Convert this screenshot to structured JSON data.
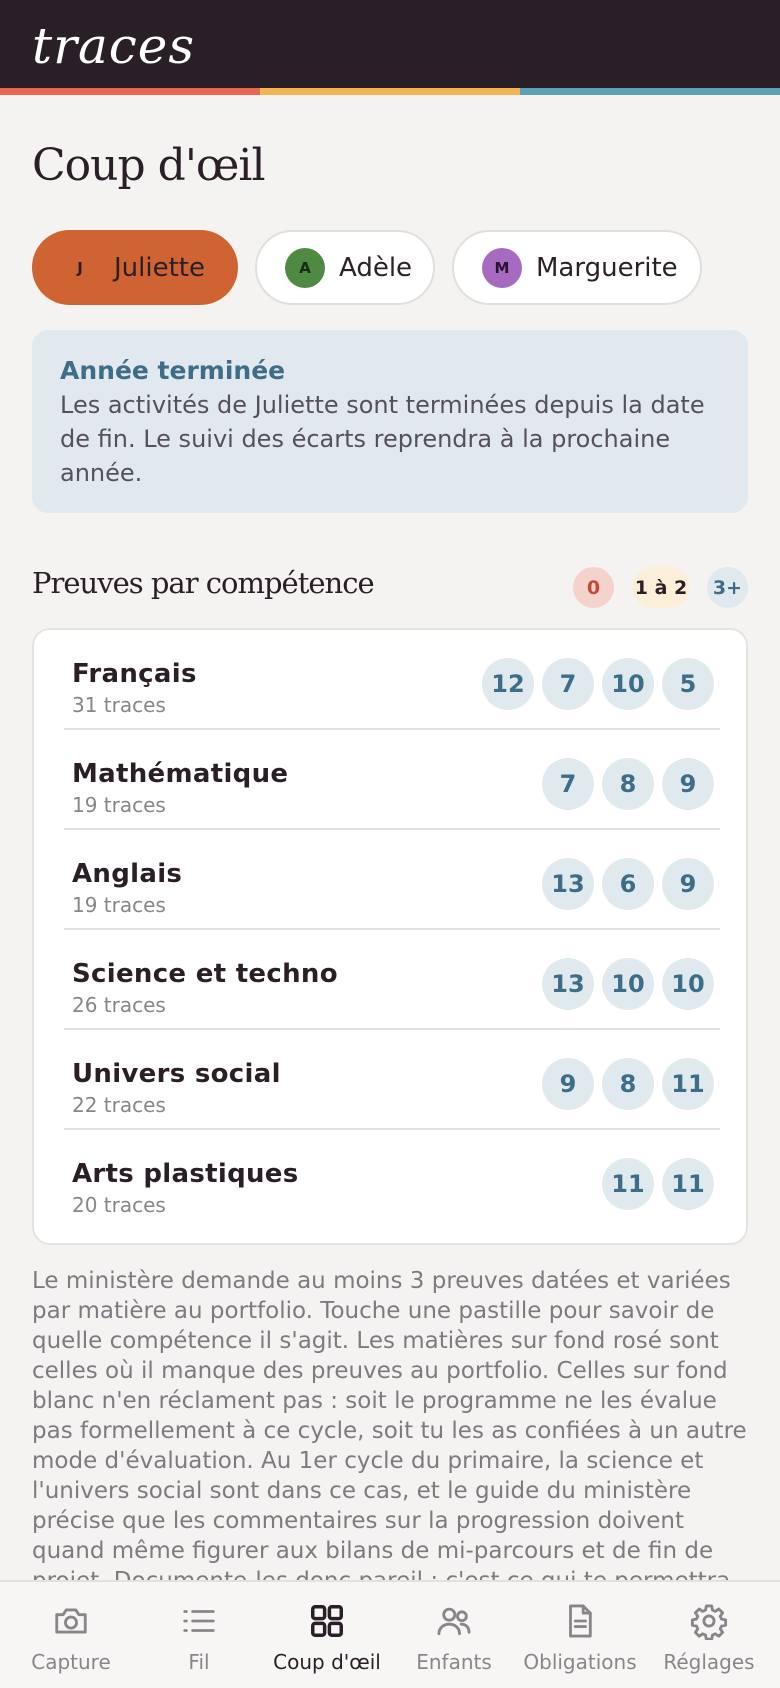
{
  "app": {
    "logo": "traces"
  },
  "page": {
    "title": "Coup d'œil"
  },
  "children": [
    {
      "initial": "J",
      "name": "Juliette",
      "selected": true,
      "color": "#cf6332"
    },
    {
      "initial": "A",
      "name": "Adèle",
      "selected": false,
      "color": "#4f8a43"
    },
    {
      "initial": "M",
      "name": "Marguerite",
      "selected": false,
      "color": "#a66ac0"
    }
  ],
  "notice": {
    "title": "Année terminée",
    "body": "Les activités de Juliette sont terminées depuis la date de fin. Le suivi des écarts reprendra à la prochaine année."
  },
  "section": {
    "title": "Preuves par compétence",
    "legend": [
      "0",
      "1 à 2",
      "3+"
    ]
  },
  "subjects": [
    {
      "name": "Français",
      "count": "31 traces",
      "pills": [
        "12",
        "7",
        "10",
        "5"
      ]
    },
    {
      "name": "Mathématique",
      "count": "19 traces",
      "pills": [
        "7",
        "8",
        "9"
      ]
    },
    {
      "name": "Anglais",
      "count": "19 traces",
      "pills": [
        "13",
        "6",
        "9"
      ]
    },
    {
      "name": "Science et techno",
      "count": "26 traces",
      "pills": [
        "13",
        "10",
        "10"
      ]
    },
    {
      "name": "Univers social",
      "count": "22 traces",
      "pills": [
        "9",
        "8",
        "11"
      ]
    },
    {
      "name": "Arts plastiques",
      "count": "20 traces",
      "pills": [
        "11",
        "11"
      ]
    }
  ],
  "footnote": "Le ministère demande au moins 3 preuves datées et variées par matière au portfolio. Touche une pastille pour savoir de quelle compétence il s'agit. Les matières sur fond rosé sont celles où il manque des preuves au portfolio. Celles sur fond blanc n'en réclament pas : soit le programme ne les évalue pas formellement à ce cycle, soit tu les as confiées à un autre mode d'évaluation. Au 1er cycle du primaire, la science et l'univers social sont dans ce cas, et le guide du ministère précise que les commentaires sur la progression doivent quand même figurer aux bilans de mi-parcours et de fin de projet. Documente-les donc pareil : c'est ce qui te permettra",
  "tabs": [
    {
      "label": "Capture",
      "icon": "camera-icon",
      "active": false
    },
    {
      "label": "Fil",
      "icon": "list-icon",
      "active": false
    },
    {
      "label": "Coup d'œil",
      "icon": "grid-icon",
      "active": true
    },
    {
      "label": "Enfants",
      "icon": "users-icon",
      "active": false
    },
    {
      "label": "Obligations",
      "icon": "document-icon",
      "active": false
    },
    {
      "label": "Réglages",
      "icon": "gear-icon",
      "active": false
    }
  ],
  "colors": {
    "header": "#2a1f26",
    "stripe": [
      "#e8674e",
      "#f2b552",
      "#5f9fb6"
    ],
    "accent": "#cf6332",
    "pill": "#dfe9ee",
    "pill_text": "#3d6d88"
  }
}
